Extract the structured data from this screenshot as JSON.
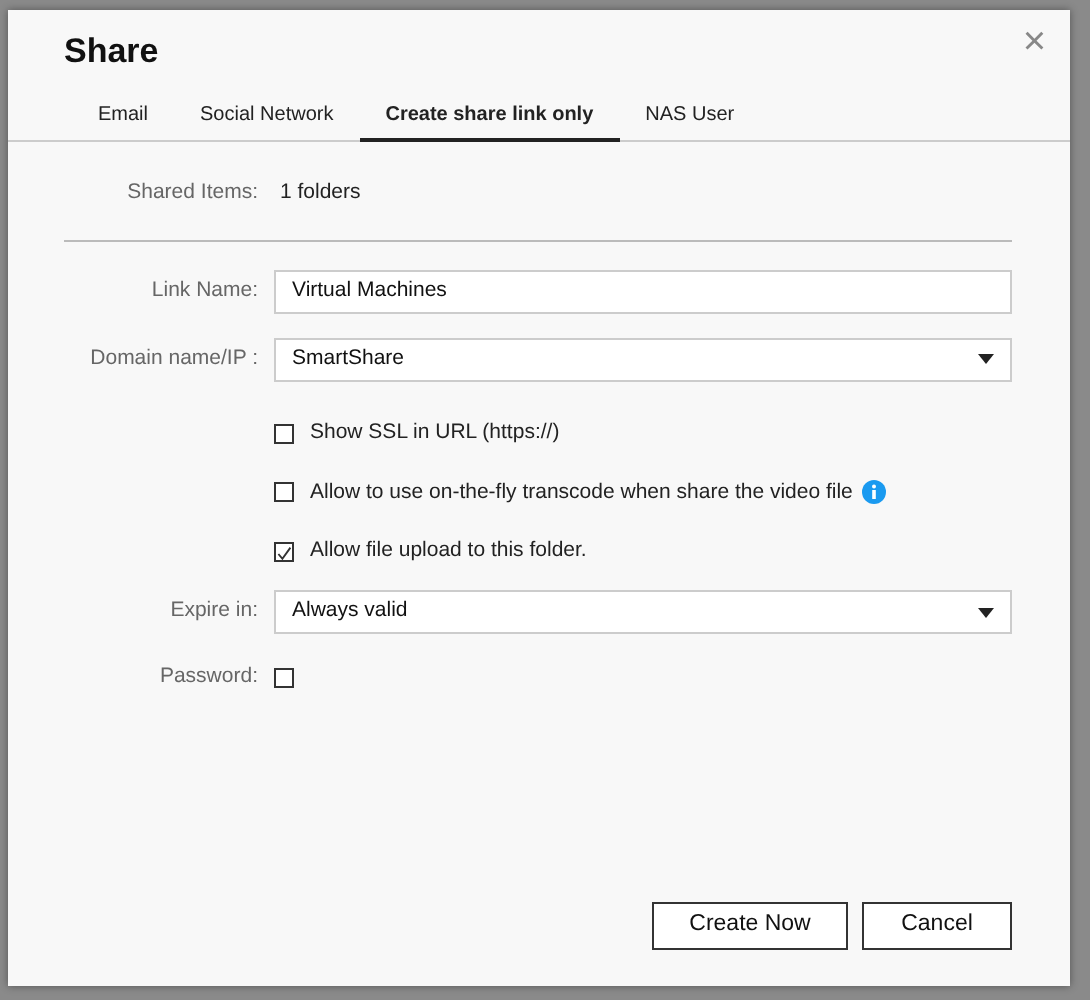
{
  "dialog": {
    "title": "Share",
    "close": "×"
  },
  "tabs": [
    {
      "label": "Email",
      "selected": false
    },
    {
      "label": "Social Network",
      "selected": false
    },
    {
      "label": "Create share link only",
      "selected": true
    },
    {
      "label": "NAS User",
      "selected": false
    }
  ],
  "shared_items": {
    "label": "Shared Items:",
    "value": "1 folders"
  },
  "rows": [
    {
      "kind": "text",
      "label": "Link Name:",
      "value": "Virtual Machines"
    },
    {
      "kind": "select",
      "label": "Domain name/IP :",
      "value": "SmartShare"
    },
    {
      "kind": "option",
      "text": "Show SSL in URL (https://)",
      "checked": false,
      "info": false
    },
    {
      "kind": "option",
      "text": "Allow to use on-the-fly transcode when share the video file",
      "checked": false,
      "info": true
    },
    {
      "kind": "option",
      "text": "Allow file upload to this folder.",
      "checked": true,
      "info": false
    },
    {
      "kind": "select",
      "label": "Expire in:",
      "value": "Always valid"
    },
    {
      "kind": "check",
      "label": "Password:",
      "checked": false
    }
  ],
  "buttons": [
    {
      "label": "Create Now"
    },
    {
      "label": "Cancel"
    }
  ]
}
